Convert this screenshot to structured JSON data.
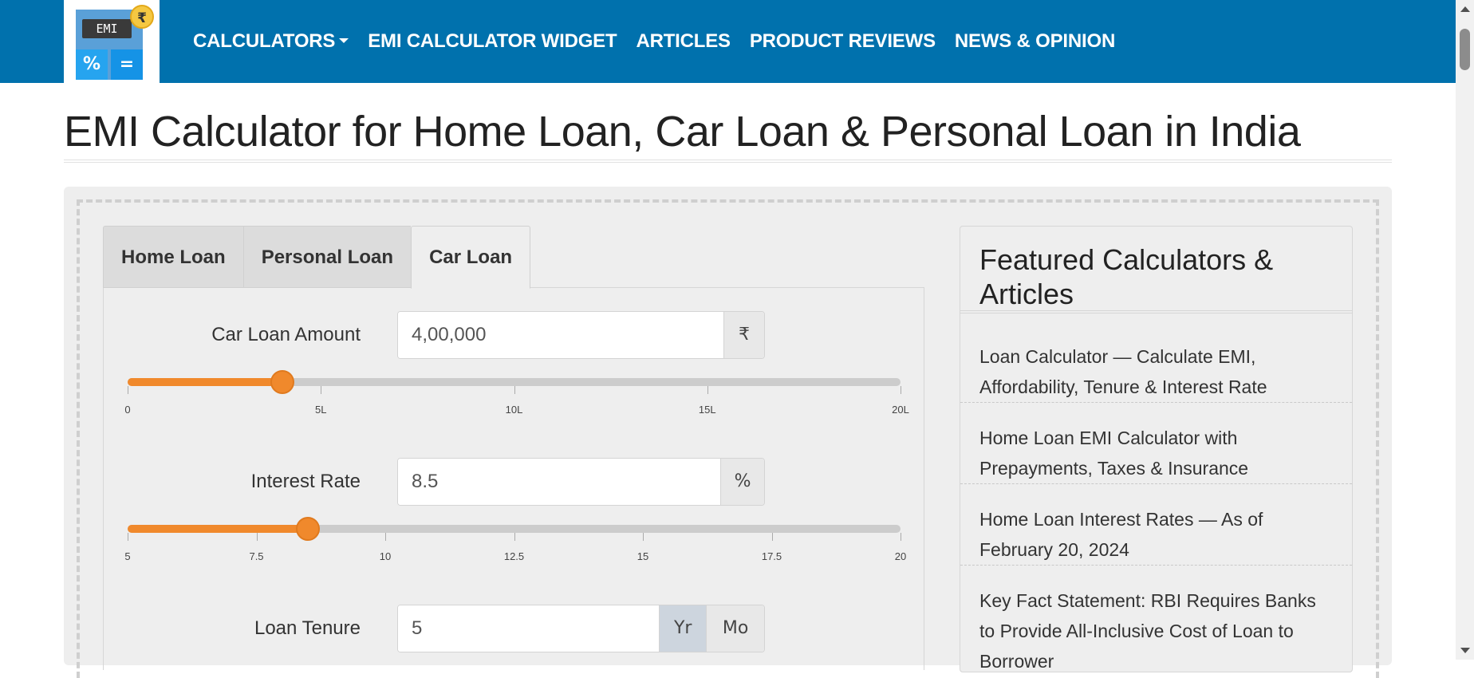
{
  "nav": {
    "logo": {
      "screen_text": "EMI",
      "key_left": "%",
      "key_right": "=",
      "coin": "₹"
    },
    "items": [
      {
        "label": "CALCULATORS",
        "has_dropdown": true
      },
      {
        "label": "EMI CALCULATOR WIDGET"
      },
      {
        "label": "ARTICLES"
      },
      {
        "label": "PRODUCT REVIEWS"
      },
      {
        "label": "NEWS & OPINION"
      }
    ]
  },
  "page": {
    "title": "EMI Calculator for Home Loan, Car Loan & Personal Loan in India"
  },
  "tabs": [
    {
      "label": "Home Loan",
      "active": false
    },
    {
      "label": "Personal Loan",
      "active": false
    },
    {
      "label": "Car Loan",
      "active": true
    }
  ],
  "form": {
    "amount": {
      "label": "Car Loan Amount",
      "value": "4,00,000",
      "addon": "₹",
      "slider_fraction": 0.2,
      "ticks": [
        "0",
        "5L",
        "10L",
        "15L",
        "20L"
      ]
    },
    "interest": {
      "label": "Interest Rate",
      "value": "8.5",
      "addon": "%",
      "slider_fraction": 0.233,
      "ticks": [
        "5",
        "7.5",
        "10",
        "12.5",
        "15",
        "17.5",
        "20"
      ]
    },
    "tenure": {
      "label": "Loan Tenure",
      "value": "5",
      "unit_year": "Yr",
      "unit_month": "Mo",
      "selected_unit": "Yr"
    }
  },
  "featured": {
    "title": "Featured Calculators & Articles",
    "links": [
      "Loan Calculator — Calculate EMI, Affordability, Tenure & Interest Rate",
      "Home Loan EMI Calculator with Prepayments, Taxes & Insurance",
      "Home Loan Interest Rates — As of February 20, 2024",
      "Key Fact Statement: RBI Requires Banks to Provide All-Inclusive Cost of Loan to Borrower"
    ]
  },
  "colors": {
    "nav_bg": "#0071ad",
    "slider_accent": "#f0892c",
    "panel_bg": "#eeeeee"
  }
}
